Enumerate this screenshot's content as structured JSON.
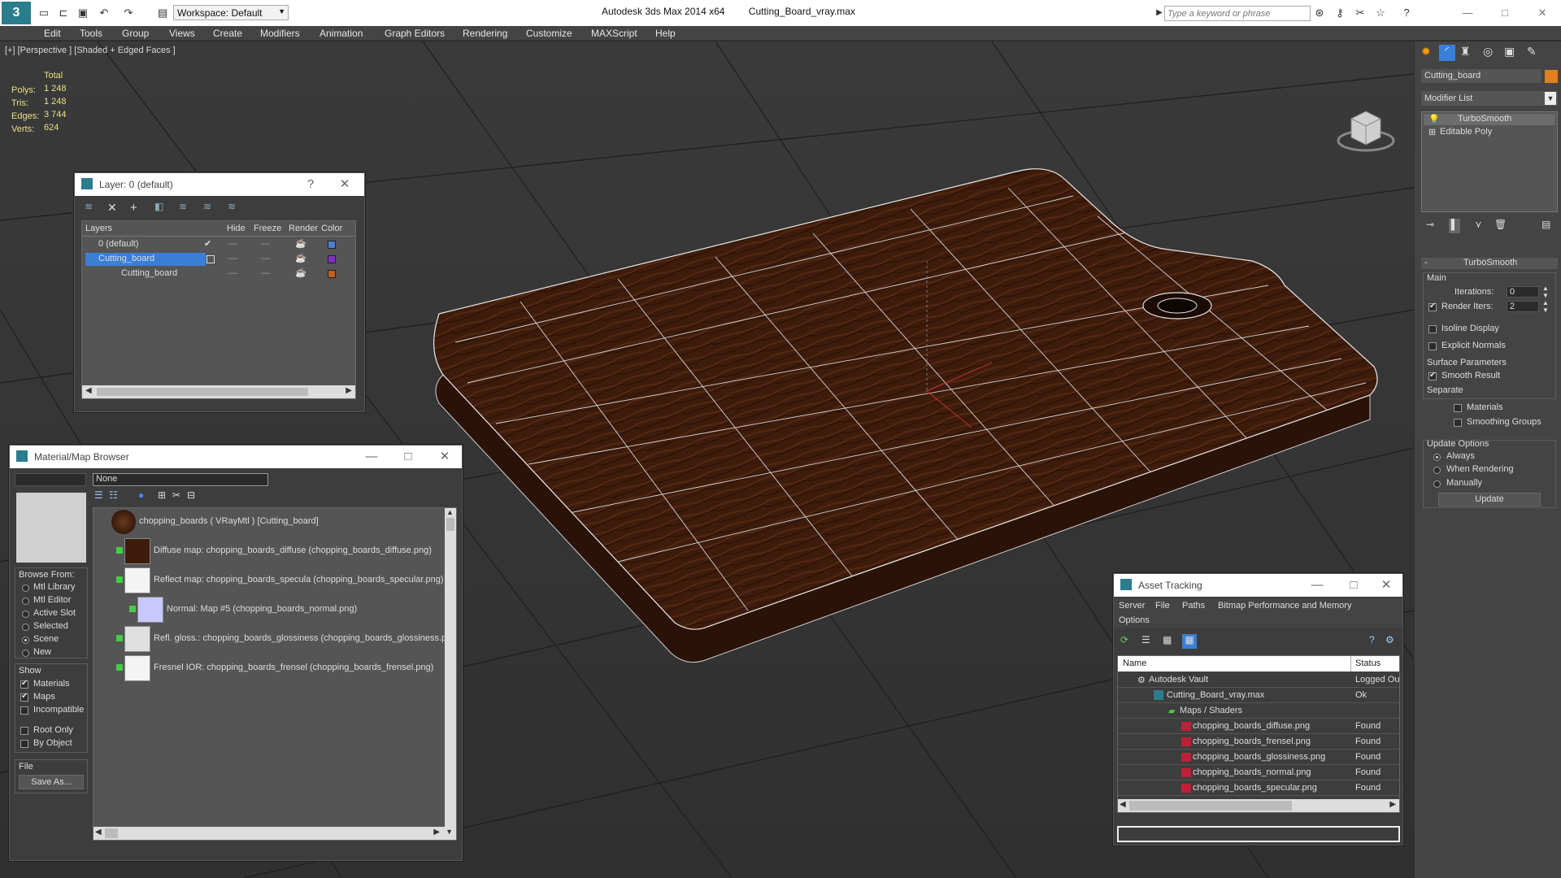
{
  "app": {
    "title": "Autodesk 3ds Max  2014 x64",
    "file": "Cutting_Board_vray.max",
    "workspace": "Workspace: Default",
    "search_placeholder": "Type a keyword or phrase"
  },
  "menu": [
    "Edit",
    "Tools",
    "Group",
    "Views",
    "Create",
    "Modifiers",
    "Animation",
    "Graph Editors",
    "Rendering",
    "Customize",
    "MAXScript",
    "Help"
  ],
  "viewport": {
    "label": "[+] [Perspective ] [Shaded + Edged Faces ]",
    "stats_header": "Total",
    "stats": [
      {
        "label": "Polys:",
        "value": "1 248"
      },
      {
        "label": "Tris:",
        "value": "1 248"
      },
      {
        "label": "Edges:",
        "value": "3 744"
      },
      {
        "label": "Verts:",
        "value": "624"
      }
    ]
  },
  "layer_window": {
    "title": "Layer: 0 (default)",
    "help": "?",
    "columns": [
      "Layers",
      "Hide",
      "Freeze",
      "Render",
      "Color"
    ],
    "rows": [
      {
        "name": "0 (default)",
        "color": "#4a7fd6"
      },
      {
        "name": "Cutting_board",
        "color": "#8030c0"
      },
      {
        "name": "Cutting_board",
        "color": "#c06020"
      }
    ]
  },
  "material_browser": {
    "title": "Material/Map Browser",
    "search_value": "None",
    "browse_from_label": "Browse From:",
    "browse_from": [
      "Mtl Library",
      "Mtl Editor",
      "Active Slot",
      "Selected",
      "Scene",
      "New"
    ],
    "show_label": "Show",
    "show": [
      "Materials",
      "Maps",
      "Incompatible"
    ],
    "root_only": "Root Only",
    "by_object": "By Object",
    "file_label": "File",
    "save_as": "Save As...",
    "tree": [
      "chopping_boards  ( VRayMtl )  [Cutting_board]",
      "Diffuse map: chopping_boards_diffuse (chopping_boards_diffuse.png)",
      "Reflect map: chopping_boards_specula (chopping_boards_specular.png)",
      "Normal: Map #5 (chopping_boards_normal.png)",
      "Refl. gloss.: chopping_boards_glossiness (chopping_boards_glossiness.pr",
      "Fresnel IOR: chopping_boards_frensel (chopping_boards_frensel.png)"
    ]
  },
  "asset_tracking": {
    "title": "Asset Tracking",
    "menu": [
      "Server",
      "File",
      "Paths",
      "Bitmap Performance and Memory",
      "Options"
    ],
    "columns": [
      "Name",
      "Status"
    ],
    "rows": [
      {
        "name": "Autodesk Vault",
        "status": "Logged Ou"
      },
      {
        "name": "Cutting_Board_vray.max",
        "status": "Ok"
      },
      {
        "name": "Maps / Shaders",
        "status": ""
      },
      {
        "name": "chopping_boards_diffuse.png",
        "status": "Found"
      },
      {
        "name": "chopping_boards_frensel.png",
        "status": "Found"
      },
      {
        "name": "chopping_boards_glossiness.png",
        "status": "Found"
      },
      {
        "name": "chopping_boards_normal.png",
        "status": "Found"
      },
      {
        "name": "chopping_boards_specular.png",
        "status": "Found"
      }
    ]
  },
  "command_panel": {
    "object_name": "Cutting_board",
    "object_color": "#e08020",
    "modifier_list": "Modifier List",
    "stack": [
      "TurboSmooth",
      "Editable Poly"
    ],
    "rollout_title": "TurboSmooth",
    "main_label": "Main",
    "iterations_label": "Iterations:",
    "iterations_value": "0",
    "render_iters_label": "Render Iters:",
    "render_iters_value": "2",
    "isoline": "Isoline Display",
    "explicit_normals": "Explicit Normals",
    "surface_params": "Surface Parameters",
    "smooth_result": "Smooth Result",
    "separate": "Separate",
    "materials": "Materials",
    "smoothing_groups": "Smoothing Groups",
    "update_options": "Update Options",
    "always": "Always",
    "when_rendering": "When Rendering",
    "manually": "Manually",
    "update_button": "Update"
  }
}
